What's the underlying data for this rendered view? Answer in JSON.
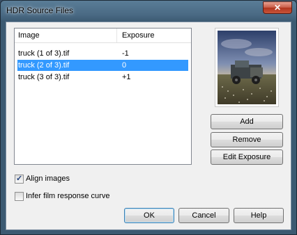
{
  "window": {
    "title": "HDR Source Files",
    "close_glyph": "✕"
  },
  "list": {
    "headers": {
      "image": "Image",
      "exposure": "Exposure"
    },
    "rows": [
      {
        "image": "truck (1 of 3).tif",
        "exposure": "-1",
        "selected": false
      },
      {
        "image": "truck (2 of 3).tif",
        "exposure": "0",
        "selected": true
      },
      {
        "image": "truck (3 of 3).tif",
        "exposure": "+1",
        "selected": false
      }
    ]
  },
  "buttons": {
    "add": "Add",
    "remove": "Remove",
    "edit_exposure": "Edit Exposure",
    "ok": "OK",
    "cancel": "Cancel",
    "help": "Help"
  },
  "options": {
    "align_images": {
      "label": "Align images",
      "checked": true
    },
    "infer_curve": {
      "label": "Infer film response curve",
      "checked": false
    }
  },
  "icons": {
    "check_glyph": "✓"
  },
  "colors": {
    "selection": "#3399ff",
    "titlebar": "#4a6a84"
  }
}
